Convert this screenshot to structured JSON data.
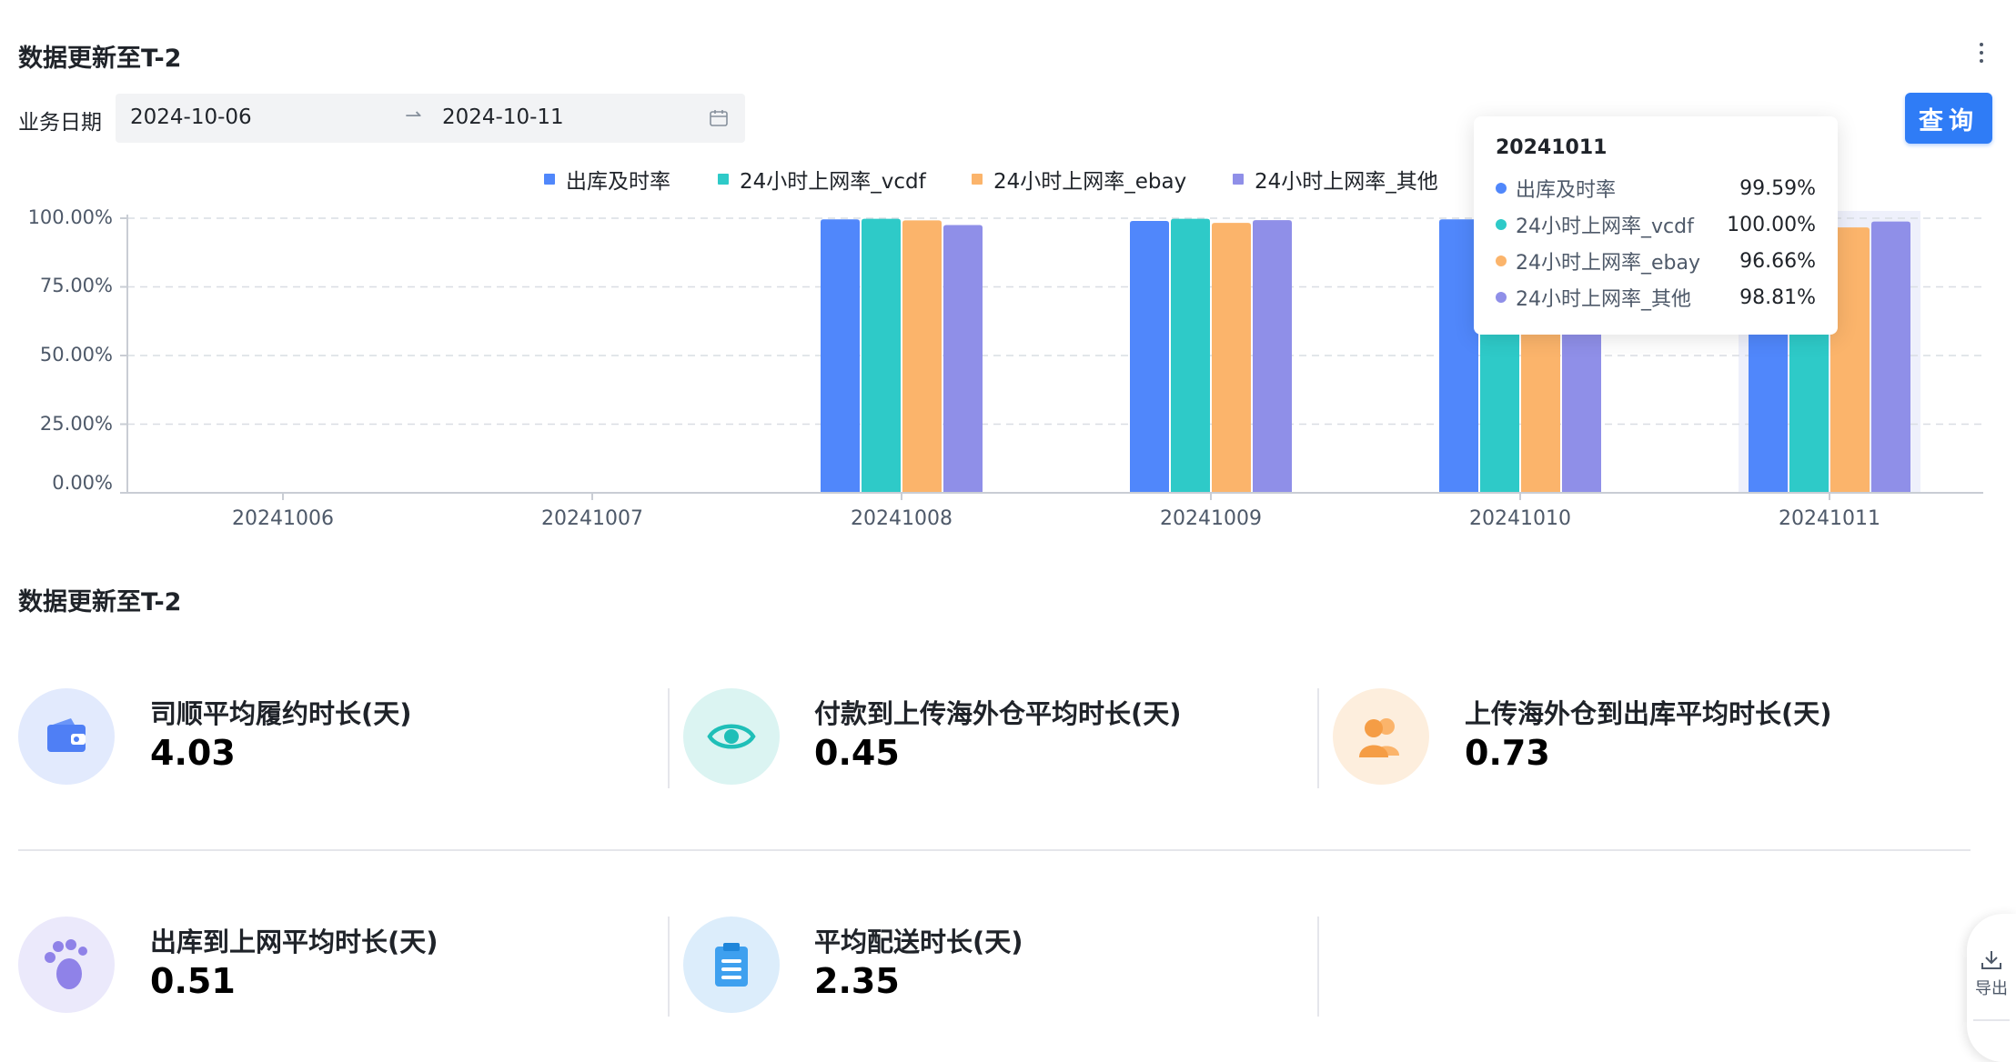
{
  "section1": {
    "title": "数据更新至T-2"
  },
  "filter": {
    "label": "业务日期",
    "start_date": "2024-10-06",
    "end_date": "2024-10-11",
    "separator": "→",
    "query_button": "查询"
  },
  "chart_data": {
    "type": "bar",
    "categories": [
      "20241006",
      "20241007",
      "20241008",
      "20241009",
      "20241010",
      "20241011"
    ],
    "series": [
      {
        "name": "出库及时率",
        "color": "#5087fb",
        "values": [
          null,
          null,
          99.6,
          99.0,
          99.6,
          99.59
        ]
      },
      {
        "name": "24小时上网率_vcdf",
        "color": "#2ecac8",
        "values": [
          null,
          null,
          99.8,
          99.8,
          99.7,
          100.0
        ]
      },
      {
        "name": "24小时上网率_ebay",
        "color": "#fbb46b",
        "values": [
          null,
          null,
          99.2,
          98.3,
          96.7,
          96.66
        ]
      },
      {
        "name": "24小时上网率_其他",
        "color": "#8f8fe8",
        "values": [
          null,
          null,
          97.5,
          99.3,
          97.3,
          98.81
        ]
      }
    ],
    "y_ticks": [
      "100.00%",
      "75.00%",
      "50.00%",
      "25.00%",
      "0.00%"
    ],
    "ylim": [
      0,
      100
    ],
    "grid": true,
    "legend_position": "top-center",
    "highlighted_category": "20241011"
  },
  "tooltip": {
    "title": "20241011",
    "rows": [
      {
        "label": "出库及时率",
        "value": "99.59%",
        "color": "#5087fb"
      },
      {
        "label": "24小时上网率_vcdf",
        "value": "100.00%",
        "color": "#2ecac8"
      },
      {
        "label": "24小时上网率_ebay",
        "value": "96.66%",
        "color": "#fbb46b"
      },
      {
        "label": "24小时上网率_其他",
        "value": "98.81%",
        "color": "#8f8fe8"
      }
    ]
  },
  "section2": {
    "title": "数据更新至T-2"
  },
  "metrics": [
    {
      "label": "司顺平均履约时长(天)",
      "value": "4.03",
      "icon": "wallet-icon"
    },
    {
      "label": "付款到上传海外仓平均时长(天)",
      "value": "0.45",
      "icon": "eye-icon"
    },
    {
      "label": "上传海外仓到出库平均时长(天)",
      "value": "0.73",
      "icon": "users-icon"
    },
    {
      "label": "出库到上网平均时长(天)",
      "value": "0.51",
      "icon": "footprint-icon"
    },
    {
      "label": "平均配送时长(天)",
      "value": "2.35",
      "icon": "clipboard-icon"
    }
  ],
  "side_panel": {
    "export_label": "导出"
  }
}
